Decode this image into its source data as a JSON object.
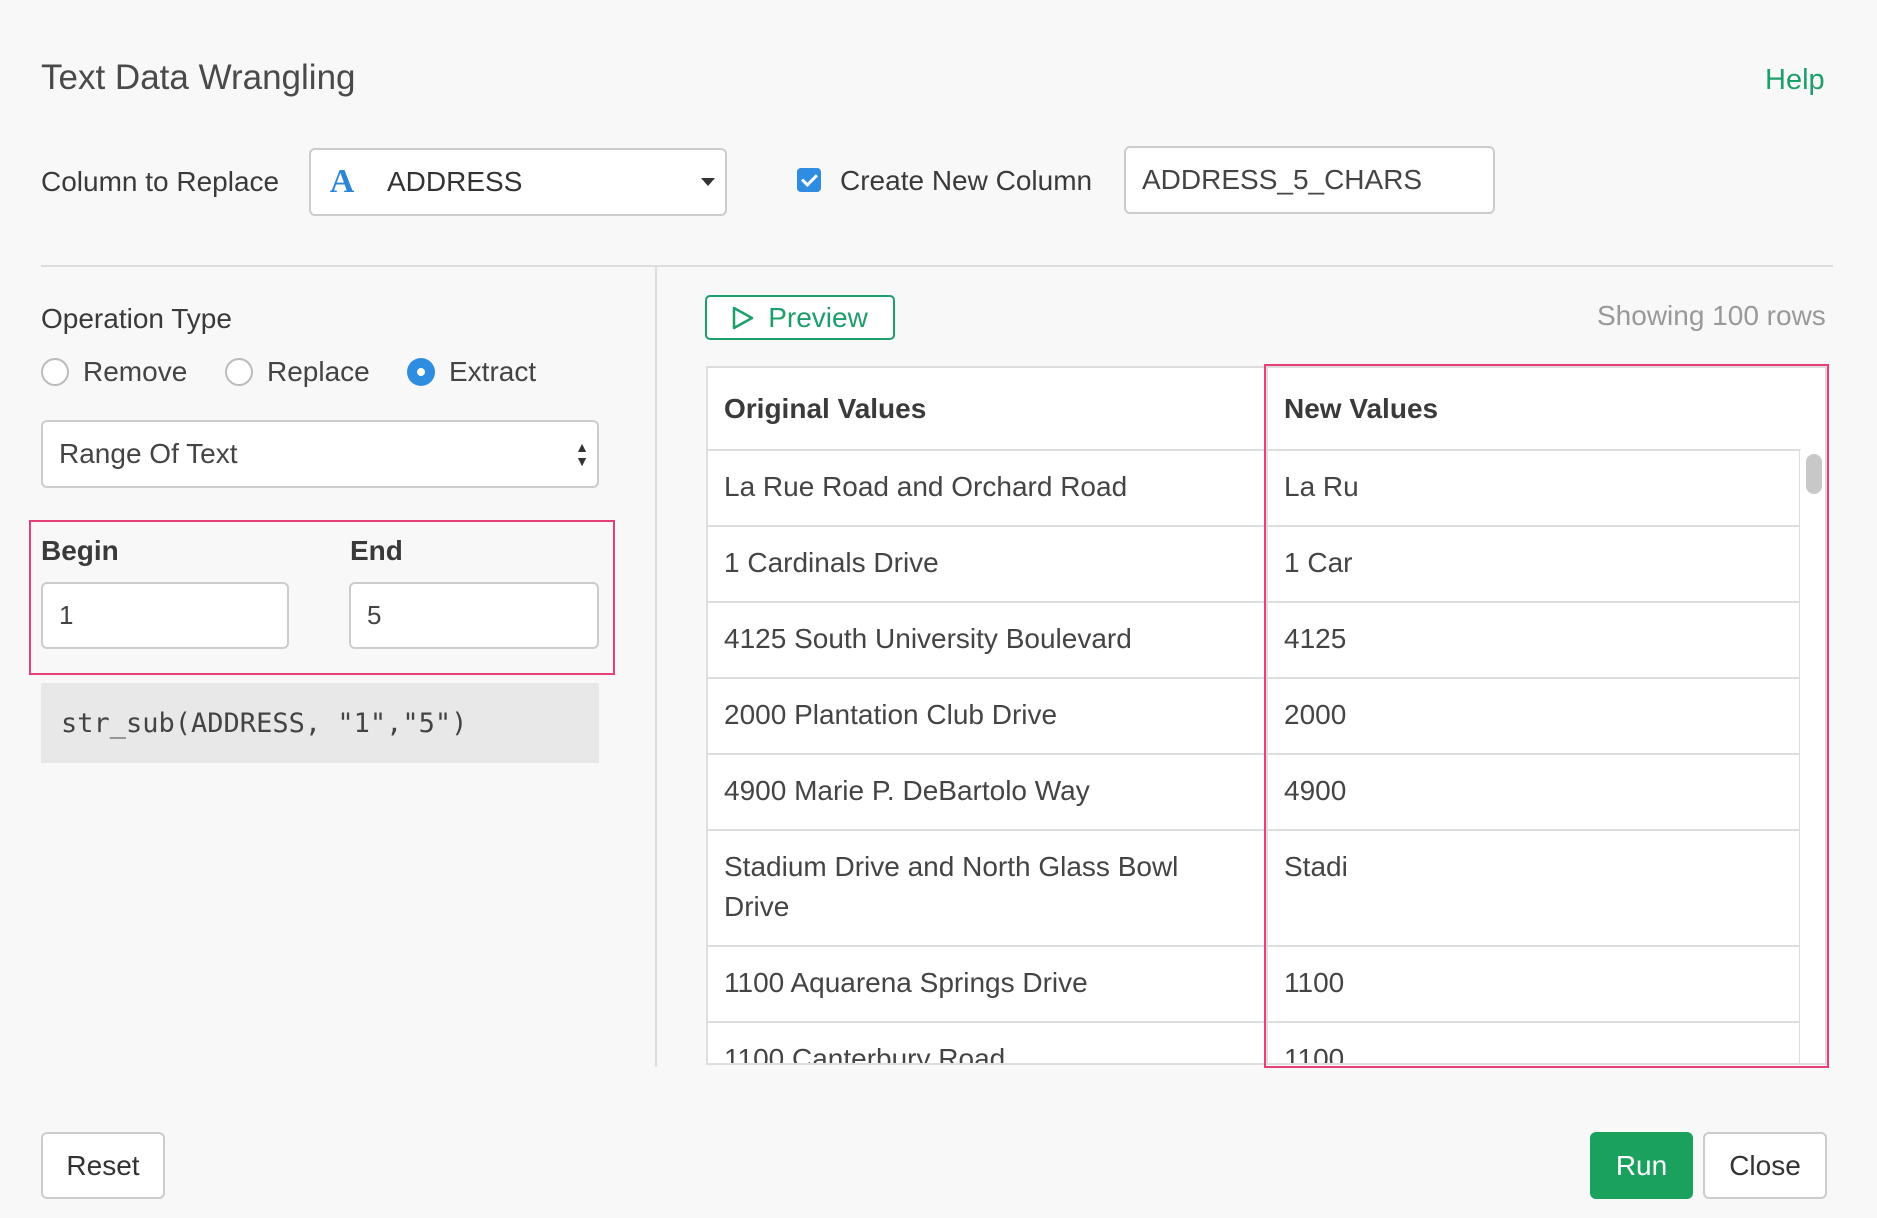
{
  "header": {
    "title": "Text Data Wrangling",
    "help_label": "Help"
  },
  "column_to_replace": {
    "label": "Column to Replace",
    "type_icon": "A",
    "value": "ADDRESS"
  },
  "create_new_column": {
    "checked": true,
    "label": "Create New Column",
    "value": "ADDRESS_5_CHARS"
  },
  "operation": {
    "label": "Operation Type",
    "options": [
      "Remove",
      "Replace",
      "Extract"
    ],
    "selected": "Extract",
    "mode": "Range Of Text"
  },
  "range": {
    "begin_label": "Begin",
    "begin_value": "1",
    "end_label": "End",
    "end_value": "5"
  },
  "expression": "str_sub(ADDRESS, \"1\",\"5\")",
  "preview": {
    "button_label": "Preview",
    "showing": "Showing 100 rows",
    "headers": [
      "Original Values",
      "New Values"
    ],
    "rows": [
      [
        "La Rue Road and Orchard Road",
        "La Ru"
      ],
      [
        "1 Cardinals Drive",
        "1 Car"
      ],
      [
        "4125 South University Boulevard",
        "4125"
      ],
      [
        "2000 Plantation Club Drive",
        "2000"
      ],
      [
        "4900 Marie P. DeBartolo Way",
        "4900"
      ],
      [
        "Stadium Drive and North Glass Bowl Drive",
        "Stadi"
      ],
      [
        "1100 Aquarena Springs Drive",
        "1100"
      ],
      [
        "1100 Canterbury Road",
        "1100"
      ]
    ]
  },
  "footer": {
    "reset_label": "Reset",
    "run_label": "Run",
    "close_label": "Close"
  },
  "colors": {
    "accent_green": "#1d9e6a",
    "run_green": "#1aa15e",
    "accent_blue": "#2e8de0",
    "highlight_pink": "#e5407a"
  }
}
